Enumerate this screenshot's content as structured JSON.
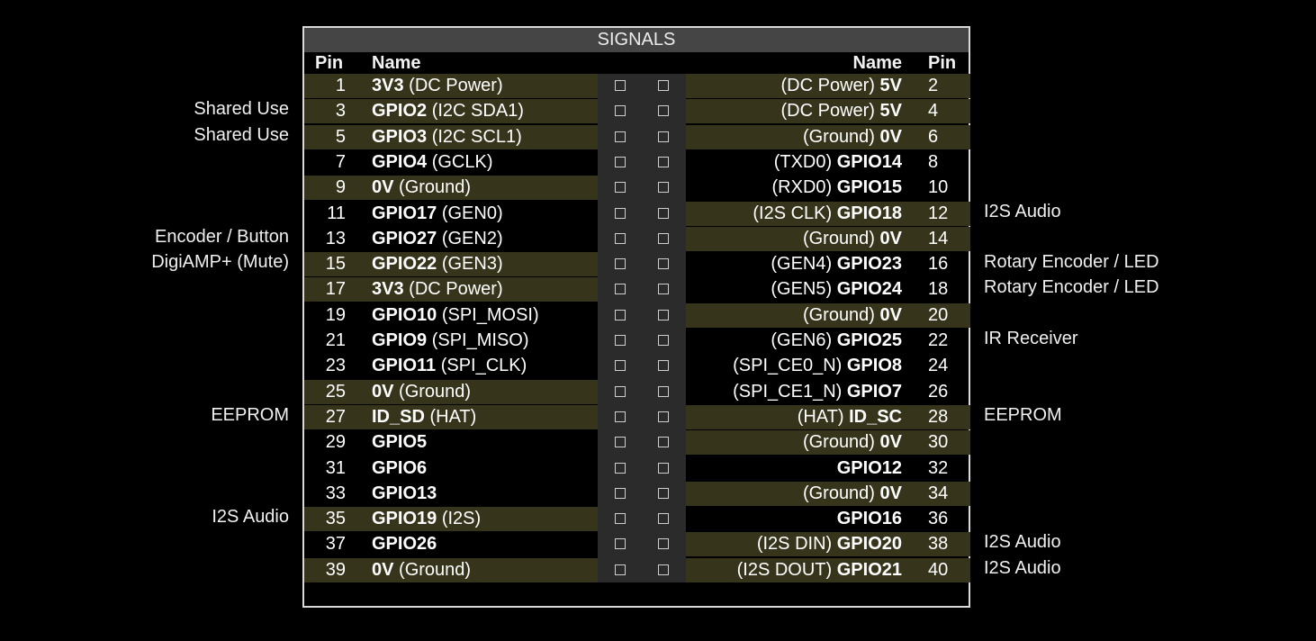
{
  "title": "SIGNALS",
  "headers": {
    "pin_left": "Pin",
    "name_left": "Name",
    "name_right": "Name",
    "pin_right": "Pin"
  },
  "colors": {
    "highlight_row": "#36351c",
    "connector_strip": "#2b2b2b",
    "title_bar": "#454545",
    "border": "#d9d9d9"
  },
  "rows": [
    {
      "lp": "1",
      "ln": "3V3",
      "ld": "(DC Power)",
      "lh": true,
      "rp": "2",
      "rn": "5V",
      "rd": "(DC Power)",
      "rh": true,
      "note_l": "",
      "note_r": ""
    },
    {
      "lp": "3",
      "ln": "GPIO2",
      "ld": "(I2C SDA1)",
      "lh": true,
      "rp": "4",
      "rn": "5V",
      "rd": "(DC Power)",
      "rh": true,
      "note_l": "Shared Use",
      "note_r": ""
    },
    {
      "lp": "5",
      "ln": "GPIO3",
      "ld": "(I2C SCL1)",
      "lh": true,
      "rp": "6",
      "rn": "0V",
      "rd": "(Ground)",
      "rh": true,
      "note_l": "Shared Use",
      "note_r": ""
    },
    {
      "lp": "7",
      "ln": "GPIO4",
      "ld": "(GCLK)",
      "lh": false,
      "rp": "8",
      "rn": "GPIO14",
      "rd": "(TXD0)",
      "rh": false,
      "note_l": "",
      "note_r": ""
    },
    {
      "lp": "9",
      "ln": "0V",
      "ld": "(Ground)",
      "lh": true,
      "rp": "10",
      "rn": "GPIO15",
      "rd": "(RXD0)",
      "rh": false,
      "note_l": "",
      "note_r": ""
    },
    {
      "lp": "11",
      "ln": "GPIO17",
      "ld": "(GEN0)",
      "lh": false,
      "rp": "12",
      "rn": "GPIO18",
      "rd": "(I2S CLK)",
      "rh": true,
      "note_l": "",
      "note_r": "I2S Audio"
    },
    {
      "lp": "13",
      "ln": "GPIO27",
      "ld": "(GEN2)",
      "lh": false,
      "rp": "14",
      "rn": "0V",
      "rd": "(Ground)",
      "rh": true,
      "note_l": "Encoder / Button",
      "note_r": ""
    },
    {
      "lp": "15",
      "ln": "GPIO22",
      "ld": "(GEN3)",
      "lh": true,
      "rp": "16",
      "rn": "GPIO23",
      "rd": "(GEN4)",
      "rh": false,
      "note_l": "DigiAMP+ (Mute)",
      "note_r": "Rotary Encoder / LED"
    },
    {
      "lp": "17",
      "ln": "3V3",
      "ld": "(DC Power)",
      "lh": true,
      "rp": "18",
      "rn": "GPIO24",
      "rd": "(GEN5)",
      "rh": false,
      "note_l": "",
      "note_r": "Rotary Encoder / LED"
    },
    {
      "lp": "19",
      "ln": "GPIO10",
      "ld": "(SPI_MOSI)",
      "lh": false,
      "rp": "20",
      "rn": "0V",
      "rd": "(Ground)",
      "rh": true,
      "note_l": "",
      "note_r": ""
    },
    {
      "lp": "21",
      "ln": "GPIO9",
      "ld": "(SPI_MISO)",
      "lh": false,
      "rp": "22",
      "rn": "GPIO25",
      "rd": "(GEN6)",
      "rh": false,
      "note_l": "",
      "note_r": "IR Receiver"
    },
    {
      "lp": "23",
      "ln": "GPIO11",
      "ld": "(SPI_CLK)",
      "lh": false,
      "rp": "24",
      "rn": "GPIO8",
      "rd": "(SPI_CE0_N)",
      "rh": false,
      "note_l": "",
      "note_r": ""
    },
    {
      "lp": "25",
      "ln": "0V",
      "ld": "(Ground)",
      "lh": true,
      "rp": "26",
      "rn": "GPIO7",
      "rd": "(SPI_CE1_N)",
      "rh": false,
      "note_l": "",
      "note_r": ""
    },
    {
      "lp": "27",
      "ln": "ID_SD",
      "ld": "(HAT)",
      "lh": true,
      "rp": "28",
      "rn": "ID_SC",
      "rd": "(HAT)",
      "rh": true,
      "note_l": "EEPROM",
      "note_r": "EEPROM"
    },
    {
      "lp": "29",
      "ln": "GPIO5",
      "ld": "",
      "lh": false,
      "rp": "30",
      "rn": "0V",
      "rd": "(Ground)",
      "rh": true,
      "note_l": "",
      "note_r": ""
    },
    {
      "lp": "31",
      "ln": "GPIO6",
      "ld": "",
      "lh": false,
      "rp": "32",
      "rn": "GPIO12",
      "rd": "",
      "rh": false,
      "note_l": "",
      "note_r": ""
    },
    {
      "lp": "33",
      "ln": "GPIO13",
      "ld": "",
      "lh": false,
      "rp": "34",
      "rn": "0V",
      "rd": "(Ground)",
      "rh": true,
      "note_l": "",
      "note_r": ""
    },
    {
      "lp": "35",
      "ln": "GPIO19",
      "ld": "(I2S)",
      "lh": true,
      "rp": "36",
      "rn": "GPIO16",
      "rd": "",
      "rh": false,
      "note_l": "I2S Audio",
      "note_r": ""
    },
    {
      "lp": "37",
      "ln": "GPIO26",
      "ld": "",
      "lh": false,
      "rp": "38",
      "rn": "GPIO20",
      "rd": "(I2S DIN)",
      "rh": true,
      "note_l": "",
      "note_r": "I2S Audio"
    },
    {
      "lp": "39",
      "ln": "0V",
      "ld": "(Ground)",
      "lh": true,
      "rp": "40",
      "rn": "GPIO21",
      "rd": "(I2S DOUT)",
      "rh": true,
      "note_l": "",
      "note_r": "I2S Audio"
    }
  ]
}
